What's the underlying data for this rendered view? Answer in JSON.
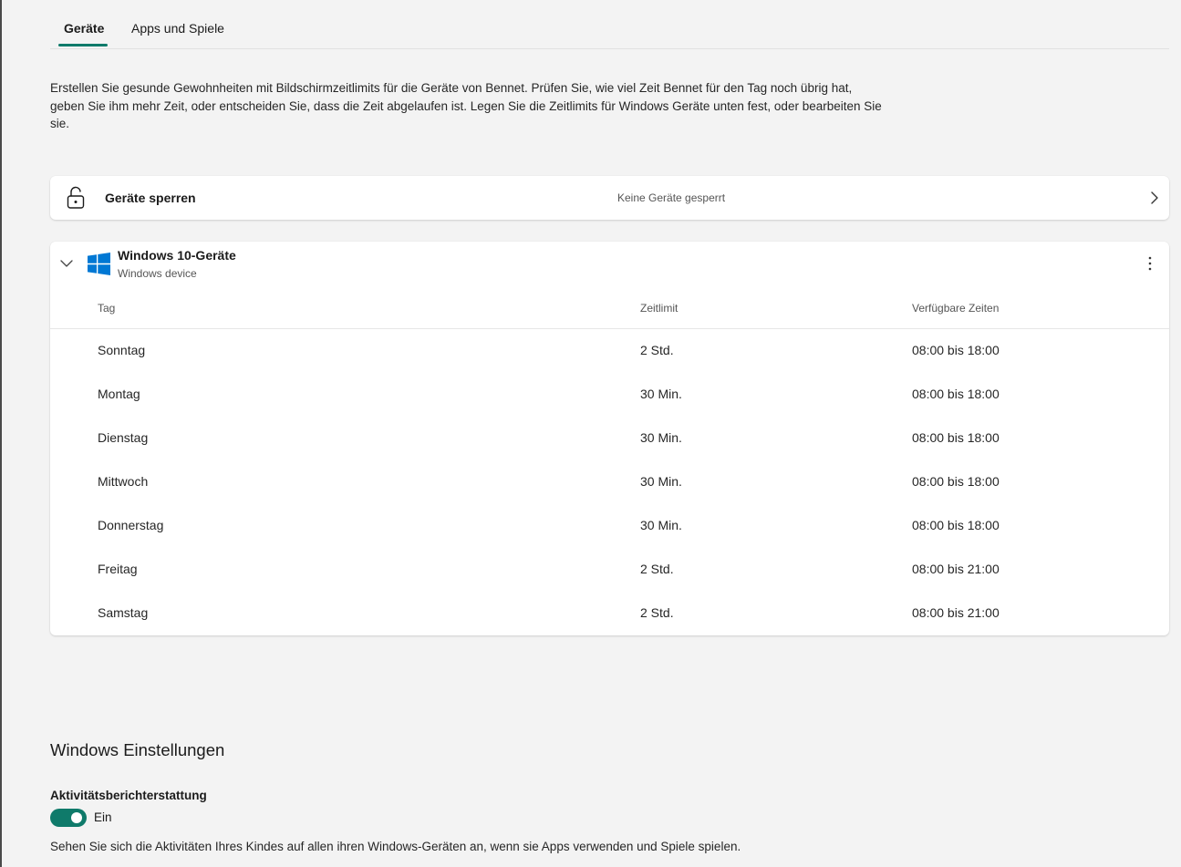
{
  "tabs": [
    {
      "label": "Geräte",
      "active": true
    },
    {
      "label": "Apps und Spiele",
      "active": false
    }
  ],
  "intro_text": "Erstellen Sie gesunde Gewohnheiten mit Bildschirmzeitlimits für die Geräte von Bennet. Prüfen Sie, wie viel Zeit Bennet für den Tag noch übrig hat, geben Sie ihm mehr Zeit, oder entscheiden Sie, dass die Zeit abgelaufen ist. Legen Sie die Zeitlimits für Windows Geräte unten fest, oder bearbeiten Sie sie.",
  "lock_card": {
    "title": "Geräte sperren",
    "status": "Keine Geräte gesperrt",
    "icon": "unlocked-padlock-icon"
  },
  "devices": {
    "title": "Windows 10-Geräte",
    "subtitle": "Windows device",
    "icon": "windows-logo-icon",
    "columns": [
      "Tag",
      "Zeitlimit",
      "Verfügbare Zeiten"
    ],
    "rows": [
      {
        "day": "Sonntag",
        "limit": "2 Std.",
        "times": "08:00 bis 18:00"
      },
      {
        "day": "Montag",
        "limit": "30 Min.",
        "times": "08:00 bis 18:00"
      },
      {
        "day": "Dienstag",
        "limit": "30 Min.",
        "times": "08:00 bis 18:00"
      },
      {
        "day": "Mittwoch",
        "limit": "30 Min.",
        "times": "08:00 bis 18:00"
      },
      {
        "day": "Donnerstag",
        "limit": "30 Min.",
        "times": "08:00 bis 18:00"
      },
      {
        "day": "Freitag",
        "limit": "2 Std.",
        "times": "08:00 bis 21:00"
      },
      {
        "day": "Samstag",
        "limit": "2 Std.",
        "times": "08:00 bis 21:00"
      }
    ]
  },
  "windows_settings": {
    "title": "Windows Einstellungen",
    "activity_label": "Aktivitätsberichterstattung",
    "toggle_state": "Ein",
    "toggle_on": true,
    "description": "Sehen Sie sich die Aktivitäten Ihres Kindes auf allen ihren Windows-Geräten an, wenn sie Apps verwenden und Spiele spielen."
  },
  "colors": {
    "accent": "#0f7a6a",
    "windows_blue": "#0078d4",
    "background": "#f3f3f3",
    "card": "#ffffff"
  }
}
